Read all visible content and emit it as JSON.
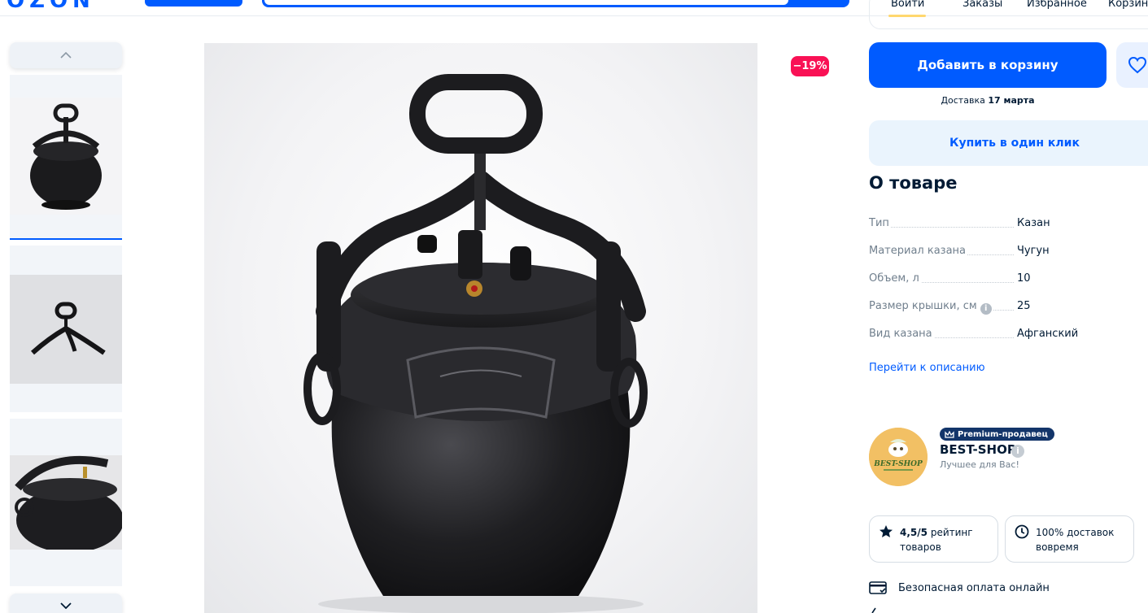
{
  "header": {
    "logo": "OZON",
    "nav": [
      {
        "label": "Войти"
      },
      {
        "label": "Заказы"
      },
      {
        "label": "Избранное"
      },
      {
        "label": "Корзина"
      }
    ]
  },
  "product": {
    "discount": "−19%",
    "image_alt": "Афганский казан-скороварка",
    "thumbnails_count": 3
  },
  "actions": {
    "add_to_cart": "Добавить в корзину",
    "delivery_prefix": "Доставка",
    "delivery_date": "17 марта",
    "buy_one_click": "Купить в один клик"
  },
  "about": {
    "title": "О товаре",
    "specs": [
      {
        "name": "Тип",
        "value": "Казан",
        "info": false
      },
      {
        "name": "Материал казана",
        "value": "Чугун",
        "info": false
      },
      {
        "name": "Объем, л",
        "value": "10",
        "info": false
      },
      {
        "name": "Размер крышки, см",
        "value": "25",
        "info": true
      },
      {
        "name": "Вид казана",
        "value": "Афганский",
        "info": false
      }
    ],
    "goto_description": "Перейти к описанию"
  },
  "seller": {
    "premium_label": "Premium-продавец",
    "name": "BEST-SHOP",
    "tagline": "Лучшее для Вас!",
    "avatar_text": "BEST-SHOP",
    "stats": [
      {
        "value": "4,5/5",
        "label": "рейтинг товаров"
      },
      {
        "value": "",
        "label": "100% доставок вовремя"
      }
    ],
    "secure_payment": "Безопасная оплата онлайн"
  },
  "colors": {
    "accent": "#005bff",
    "discount": "#f91155",
    "premium": "#13356a",
    "light_blue": "#eaf4fd"
  }
}
